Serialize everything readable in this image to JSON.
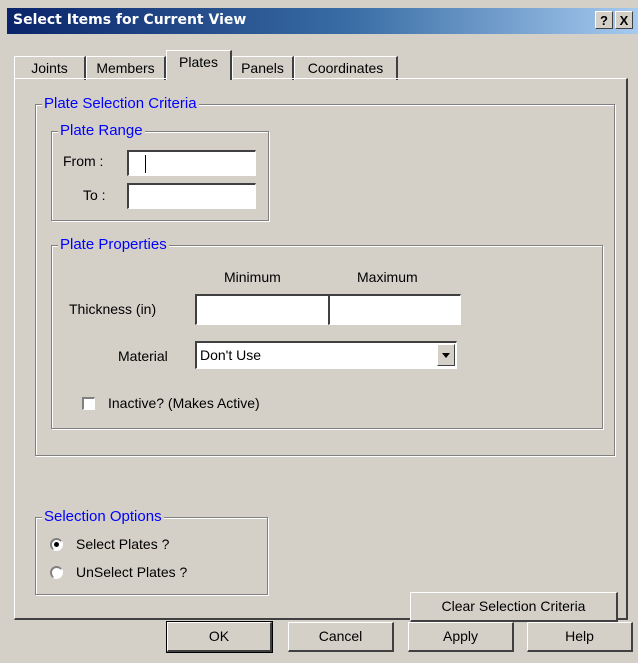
{
  "window": {
    "title": "Select Items for Current View",
    "help_button": "?",
    "close_button": "X"
  },
  "tabs": [
    {
      "label": "Joints",
      "active": false
    },
    {
      "label": "Members",
      "active": false
    },
    {
      "label": "Plates",
      "active": true
    },
    {
      "label": "Panels",
      "active": false
    },
    {
      "label": "Coordinates",
      "active": false
    }
  ],
  "criteria": {
    "legend": "Plate Selection Criteria",
    "range": {
      "legend": "Plate Range",
      "from_label": "From :",
      "from_value": "",
      "to_label": "To :",
      "to_value": ""
    },
    "properties": {
      "legend": "Plate Properties",
      "minimum_header": "Minimum",
      "maximum_header": "Maximum",
      "thickness_label": "Thickness (in)",
      "thickness_min": "",
      "thickness_max": "",
      "material_label": "Material",
      "material_value": "Don't Use",
      "inactive_label": "Inactive? (Makes Active)",
      "inactive_checked": false
    }
  },
  "selection_options": {
    "legend": "Selection Options",
    "select_label": "Select Plates ?",
    "unselect_label": "UnSelect Plates ?",
    "selected": "select"
  },
  "buttons": {
    "clear": "Clear Selection Criteria",
    "ok": "OK",
    "cancel": "Cancel",
    "apply": "Apply",
    "help": "Help"
  }
}
